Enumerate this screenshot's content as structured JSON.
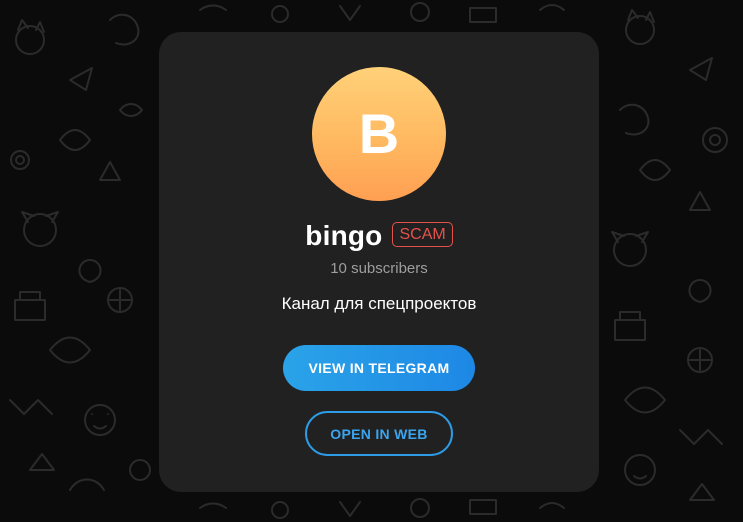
{
  "channel": {
    "avatar_letter": "B",
    "name": "bingo",
    "badge": "SCAM",
    "subscribers": "10 subscribers",
    "description": "Канал для спецпроектов"
  },
  "actions": {
    "view_in_telegram": "VIEW IN TELEGRAM",
    "open_in_web": "OPEN IN WEB"
  },
  "colors": {
    "background": "#0b0b0b",
    "card": "#212121",
    "avatar_gradient_top": "#ffd179",
    "avatar_gradient_bottom": "#ff9f52",
    "scam_red": "#e5524b",
    "accent_blue": "#2aa3e8"
  },
  "background_pattern": "cats-and-doodles"
}
